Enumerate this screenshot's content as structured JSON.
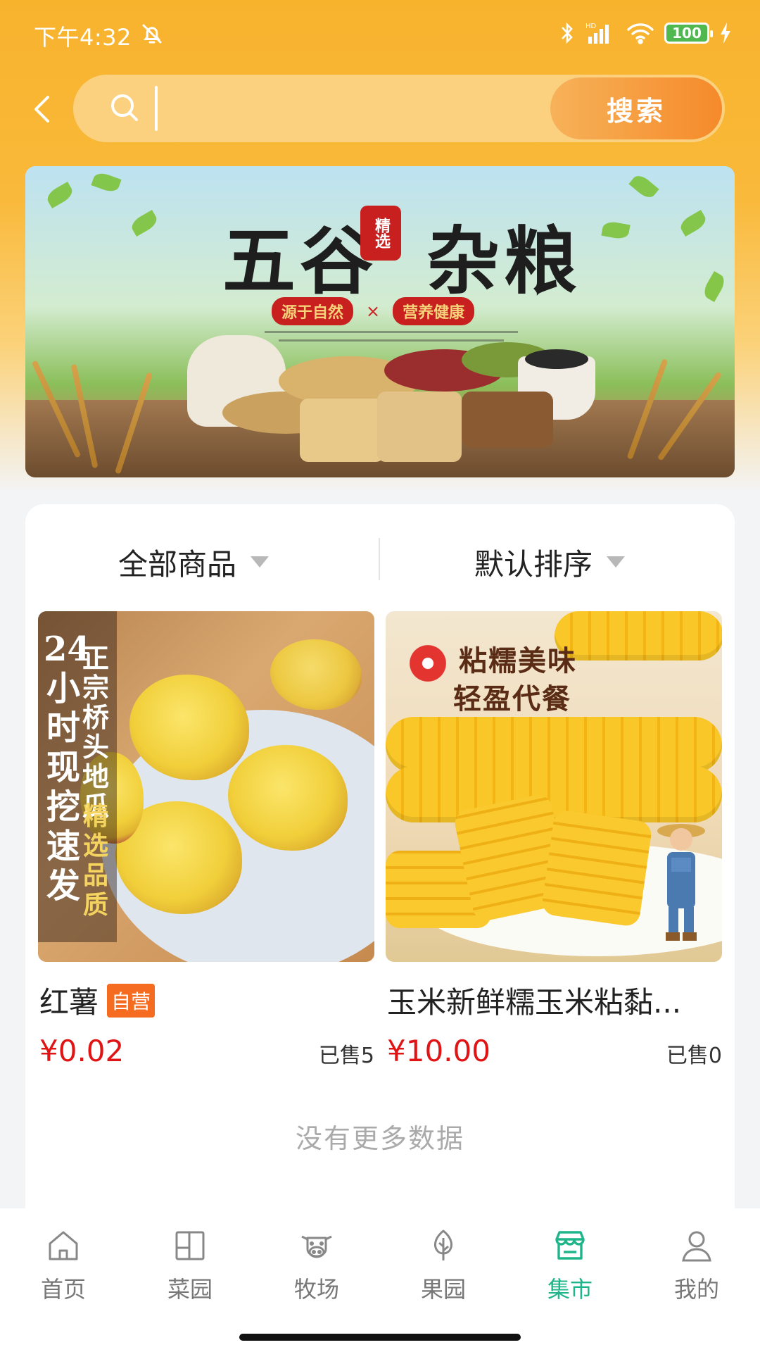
{
  "status_bar": {
    "time": "下午4:32",
    "battery": "100"
  },
  "search": {
    "placeholder": "",
    "value": "",
    "button_label": "搜索"
  },
  "banner": {
    "title_a": "五谷",
    "title_b": "杂粮",
    "seal": "精选",
    "pill_left": "源于自然",
    "pill_right": "营养健康",
    "separator": "×"
  },
  "filters": {
    "category": "全部商品",
    "sort": "默认排序"
  },
  "products": [
    {
      "name": "红薯",
      "tag": "自营",
      "price": "¥0.02",
      "sold": "已售5",
      "image_text_a": "24小时现挖速发",
      "image_text_b": "正宗桥头地瓜",
      "image_text_c": "精选品质"
    },
    {
      "name": "玉米新鲜糯玉米粘黏...",
      "price": "¥10.00",
      "sold": "已售0",
      "image_text_a": "粘糯美味",
      "image_text_b": "轻盈代餐"
    }
  ],
  "list_footer": "没有更多数据",
  "nav": [
    {
      "label": "首页",
      "icon": "home-icon",
      "active": false
    },
    {
      "label": "菜园",
      "icon": "garden-icon",
      "active": false
    },
    {
      "label": "牧场",
      "icon": "cow-icon",
      "active": false
    },
    {
      "label": "果园",
      "icon": "tree-icon",
      "active": false
    },
    {
      "label": "集市",
      "icon": "store-icon",
      "active": true
    },
    {
      "label": "我的",
      "icon": "user-icon",
      "active": false
    }
  ],
  "colors": {
    "accent": "#f8b32d",
    "nav_active": "#1fb58a",
    "price": "#e01414",
    "self_tag": "#f56b1f"
  }
}
